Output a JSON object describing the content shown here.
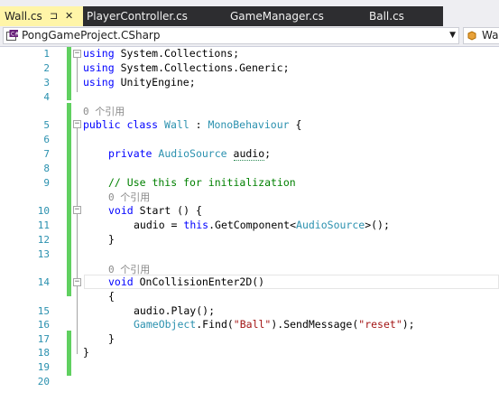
{
  "tabs": {
    "active": {
      "label": "Wall.cs",
      "pin": "⊐",
      "close": "✕"
    },
    "others": [
      {
        "label": "PlayerController.cs"
      },
      {
        "label": "GameManager.cs"
      },
      {
        "label": "Ball.cs"
      }
    ]
  },
  "nav": {
    "project": "PongGameProject.CSharp",
    "member": "Wa"
  },
  "code": {
    "line_numbers": [
      "1",
      "2",
      "3",
      "4",
      "5",
      "6",
      "7",
      "8",
      "9",
      "10",
      "11",
      "12",
      "13",
      "14",
      "15",
      "16",
      "17",
      "18",
      "19",
      "20"
    ],
    "using1": "System.Collections;",
    "using2": "System.Collections.Generic;",
    "using3": "UnityEngine;",
    "kw_using": "using",
    "ref_count": "0 个引用",
    "kw_public": "public",
    "kw_class": "class",
    "class_name": "Wall",
    "colon": " : ",
    "base_class": "MonoBehaviour",
    "open_brace_class": " {",
    "kw_private": "private",
    "audio_type": "AudioSource",
    "audio_field": "audio",
    "semicolon": ";",
    "comment": "// Use this for initialization",
    "kw_void": "void",
    "start_sig": " Start () {",
    "audio_assign_pre": "audio = ",
    "kw_this": "this",
    "get_component": ".GetComponent<",
    "audio_type2": "AudioSource",
    "get_component_end": ">();",
    "close_brace": "}",
    "collision_sig": " OnCollisionEnter2D()",
    "open_brace": "{",
    "play": "audio.Play();",
    "gameobject": "GameObject",
    "find_pre": ".Find(",
    "ball_str": "\"Ball\"",
    "send_pre": ").SendMessage(",
    "reset_str": "\"reset\"",
    "send_end": ");"
  }
}
